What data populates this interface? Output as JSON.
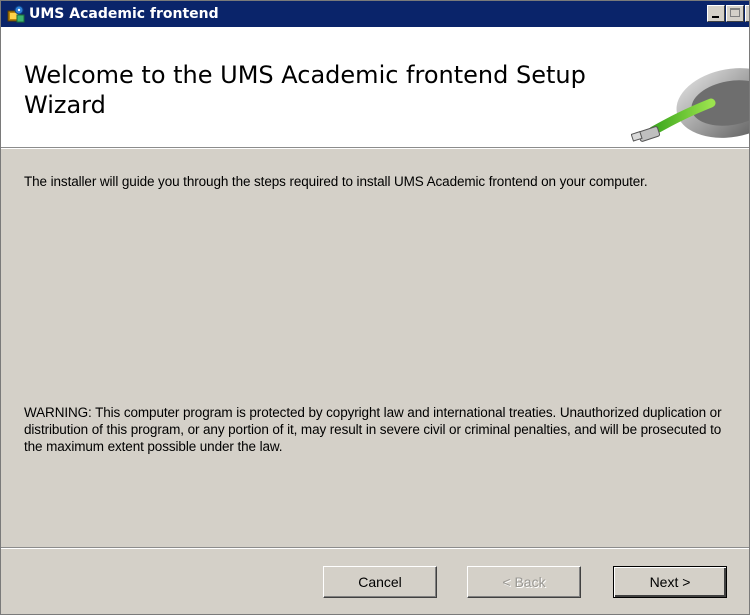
{
  "window": {
    "title": "UMS Academic frontend"
  },
  "banner": {
    "heading": "Welcome to the UMS Academic frontend Setup Wizard"
  },
  "content": {
    "intro": "The installer will guide you through the steps required to install UMS Academic frontend on your computer.",
    "warning": "WARNING: This computer program is protected by copyright law and international treaties. Unauthorized duplication or distribution of this program, or any portion of it, may result in severe civil or criminal penalties, and will be prosecuted to the maximum extent possible under the law."
  },
  "buttons": {
    "cancel": "Cancel",
    "back": "< Back",
    "next": "Next >"
  },
  "icons": {
    "title": "installer-icon",
    "banner": "cd-usb-artwork",
    "minimize": "minimize-icon",
    "maximize": "maximize-icon",
    "close": "close-icon"
  },
  "colors": {
    "titlebar": "#0a246a",
    "dialog": "#d4d0c8",
    "banner": "#ffffff",
    "disabled_text": "#9a9893"
  }
}
